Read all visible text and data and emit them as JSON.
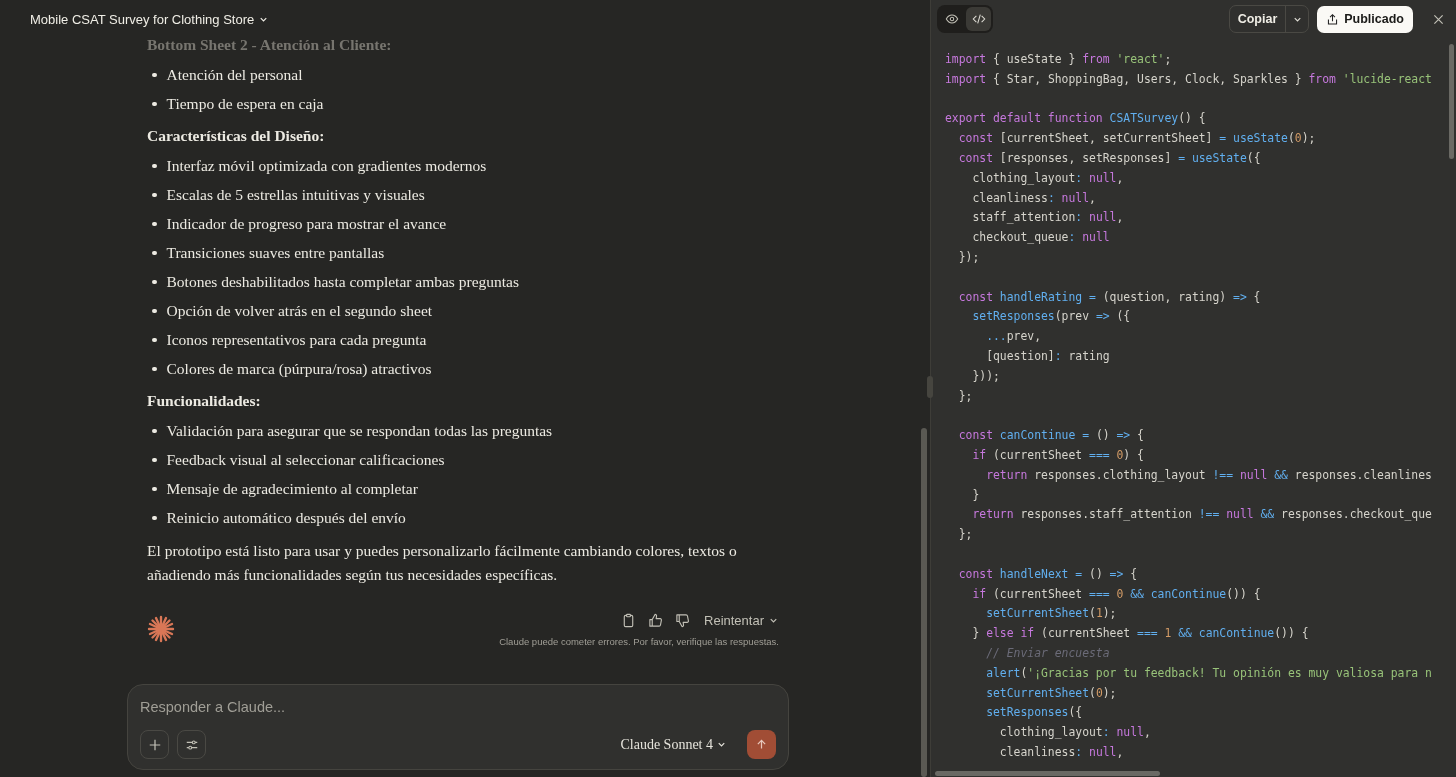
{
  "chat": {
    "title": "Mobile CSAT Survey for Clothing Store",
    "blocks": [
      {
        "kind": "heading",
        "text": "Bottom Sheet 2 - Atención al Cliente:",
        "faded": true
      },
      {
        "kind": "list",
        "faded": false,
        "items": [
          "Atención del personal",
          "Tiempo de espera en caja"
        ]
      },
      {
        "kind": "heading",
        "text": "Características del Diseño:",
        "faded": false
      },
      {
        "kind": "list",
        "faded": false,
        "items": [
          "Interfaz móvil optimizada con gradientes modernos",
          "Escalas de 5 estrellas intuitivas y visuales",
          "Indicador de progreso para mostrar el avance",
          "Transiciones suaves entre pantallas",
          "Botones deshabilitados hasta completar ambas preguntas",
          "Opción de volver atrás en el segundo sheet",
          "Iconos representativos para cada pregunta",
          "Colores de marca (púrpura/rosa) atractivos"
        ]
      },
      {
        "kind": "heading",
        "text": "Funcionalidades:",
        "faded": false
      },
      {
        "kind": "list",
        "faded": false,
        "items": [
          "Validación para asegurar que se respondan todas las preguntas",
          "Feedback visual al seleccionar calificaciones",
          "Mensaje de agradecimiento al completar",
          "Reinicio automático después del envío"
        ]
      },
      {
        "kind": "paragraph",
        "text": "El prototipo está listo para usar y puedes personalizarlo fácilmente cambiando colores, textos o añadiendo más funcionalidades según tus necesidades específicas.",
        "faded": false
      }
    ],
    "retry": "Reintentar",
    "disclaimer": "Claude puede cometer errores. Por favor, verifique las respuestas.",
    "composer": {
      "placeholder": "Responder a Claude...",
      "model": "Claude Sonnet 4"
    }
  },
  "artifact": {
    "view_toggle": [
      {
        "kind": "preview",
        "selected": false
      },
      {
        "kind": "code",
        "selected": true
      }
    ],
    "copy": "Copiar",
    "publish": "Publicado",
    "code_lines": [
      {
        "kind": "code",
        "tokens": [
          {
            "kind": "keyword",
            "text": "import"
          },
          {
            "kind": "plain",
            "text": " { useState } "
          },
          {
            "kind": "keyword",
            "text": "from"
          },
          {
            "kind": "string",
            "text": " 'react'"
          },
          {
            "kind": "plain",
            "text": ";"
          }
        ]
      },
      {
        "kind": "code",
        "tokens": [
          {
            "kind": "keyword",
            "text": "import"
          },
          {
            "kind": "plain",
            "text": " { Star, ShoppingBag, Users, Clock, Sparkles } "
          },
          {
            "kind": "keyword",
            "text": "from"
          },
          {
            "kind": "string",
            "text": " 'lucide-react"
          }
        ]
      },
      {
        "kind": "blank"
      },
      {
        "kind": "code",
        "tokens": [
          {
            "kind": "keyword",
            "text": "export default function"
          },
          {
            "kind": "function",
            "text": " CSATSurvey"
          },
          {
            "kind": "plain",
            "text": "() {"
          }
        ]
      },
      {
        "kind": "code",
        "tokens": [
          {
            "kind": "keyword",
            "text": "  const"
          },
          {
            "kind": "plain",
            "text": " [currentSheet, setCurrentSheet] "
          },
          {
            "kind": "operator",
            "text": "="
          },
          {
            "kind": "function",
            "text": " useState"
          },
          {
            "kind": "plain",
            "text": "("
          },
          {
            "kind": "number",
            "text": "0"
          },
          {
            "kind": "plain",
            "text": ");"
          }
        ]
      },
      {
        "kind": "code",
        "tokens": [
          {
            "kind": "keyword",
            "text": "  const"
          },
          {
            "kind": "plain",
            "text": " [responses, setResponses] "
          },
          {
            "kind": "operator",
            "text": "="
          },
          {
            "kind": "function",
            "text": " useState"
          },
          {
            "kind": "plain",
            "text": "({"
          }
        ]
      },
      {
        "kind": "code",
        "tokens": [
          {
            "kind": "plain",
            "text": "    clothing_layout"
          },
          {
            "kind": "operator",
            "text": ":"
          },
          {
            "kind": "keyword",
            "text": " null"
          },
          {
            "kind": "plain",
            "text": ","
          }
        ]
      },
      {
        "kind": "code",
        "tokens": [
          {
            "kind": "plain",
            "text": "    cleanliness"
          },
          {
            "kind": "operator",
            "text": ":"
          },
          {
            "kind": "keyword",
            "text": " null"
          },
          {
            "kind": "plain",
            "text": ","
          }
        ]
      },
      {
        "kind": "code",
        "tokens": [
          {
            "kind": "plain",
            "text": "    staff_attention"
          },
          {
            "kind": "operator",
            "text": ":"
          },
          {
            "kind": "keyword",
            "text": " null"
          },
          {
            "kind": "plain",
            "text": ","
          }
        ]
      },
      {
        "kind": "code",
        "tokens": [
          {
            "kind": "plain",
            "text": "    checkout_queue"
          },
          {
            "kind": "operator",
            "text": ":"
          },
          {
            "kind": "keyword",
            "text": " null"
          }
        ]
      },
      {
        "kind": "code",
        "tokens": [
          {
            "kind": "plain",
            "text": "  });"
          }
        ]
      },
      {
        "kind": "blank"
      },
      {
        "kind": "code",
        "tokens": [
          {
            "kind": "keyword",
            "text": "  const"
          },
          {
            "kind": "function",
            "text": " handleRating"
          },
          {
            "kind": "operator",
            "text": " ="
          },
          {
            "kind": "plain",
            "text": " (question, rating) "
          },
          {
            "kind": "operator",
            "text": "=>"
          },
          {
            "kind": "plain",
            "text": " {"
          }
        ]
      },
      {
        "kind": "code",
        "tokens": [
          {
            "kind": "function",
            "text": "    setResponses"
          },
          {
            "kind": "plain",
            "text": "(prev "
          },
          {
            "kind": "operator",
            "text": "=>"
          },
          {
            "kind": "plain",
            "text": " ({"
          }
        ]
      },
      {
        "kind": "code",
        "tokens": [
          {
            "kind": "operator",
            "text": "      ..."
          },
          {
            "kind": "plain",
            "text": "prev,"
          }
        ]
      },
      {
        "kind": "code",
        "tokens": [
          {
            "kind": "plain",
            "text": "      [question]"
          },
          {
            "kind": "operator",
            "text": ":"
          },
          {
            "kind": "plain",
            "text": " rating"
          }
        ]
      },
      {
        "kind": "code",
        "tokens": [
          {
            "kind": "plain",
            "text": "    }));"
          }
        ]
      },
      {
        "kind": "code",
        "tokens": [
          {
            "kind": "plain",
            "text": "  };"
          }
        ]
      },
      {
        "kind": "blank"
      },
      {
        "kind": "code",
        "tokens": [
          {
            "kind": "keyword",
            "text": "  const"
          },
          {
            "kind": "function",
            "text": " canContinue"
          },
          {
            "kind": "operator",
            "text": " ="
          },
          {
            "kind": "plain",
            "text": " () "
          },
          {
            "kind": "operator",
            "text": "=>"
          },
          {
            "kind": "plain",
            "text": " {"
          }
        ]
      },
      {
        "kind": "code",
        "tokens": [
          {
            "kind": "keyword",
            "text": "    if"
          },
          {
            "kind": "plain",
            "text": " (currentSheet "
          },
          {
            "kind": "operator",
            "text": "==="
          },
          {
            "kind": "number",
            "text": " 0"
          },
          {
            "kind": "plain",
            "text": ") {"
          }
        ]
      },
      {
        "kind": "code",
        "tokens": [
          {
            "kind": "keyword",
            "text": "      return"
          },
          {
            "kind": "plain",
            "text": " responses.clothing_layout "
          },
          {
            "kind": "operator",
            "text": "!=="
          },
          {
            "kind": "keyword",
            "text": " null"
          },
          {
            "kind": "operator",
            "text": " &&"
          },
          {
            "kind": "plain",
            "text": " responses.cleanlines"
          }
        ]
      },
      {
        "kind": "code",
        "tokens": [
          {
            "kind": "plain",
            "text": "    }"
          }
        ]
      },
      {
        "kind": "code",
        "tokens": [
          {
            "kind": "keyword",
            "text": "    return"
          },
          {
            "kind": "plain",
            "text": " responses.staff_attention "
          },
          {
            "kind": "operator",
            "text": "!=="
          },
          {
            "kind": "keyword",
            "text": " null"
          },
          {
            "kind": "operator",
            "text": " &&"
          },
          {
            "kind": "plain",
            "text": " responses.checkout_que"
          }
        ]
      },
      {
        "kind": "code",
        "tokens": [
          {
            "kind": "plain",
            "text": "  };"
          }
        ]
      },
      {
        "kind": "blank"
      },
      {
        "kind": "code",
        "tokens": [
          {
            "kind": "keyword",
            "text": "  const"
          },
          {
            "kind": "function",
            "text": " handleNext"
          },
          {
            "kind": "operator",
            "text": " ="
          },
          {
            "kind": "plain",
            "text": " () "
          },
          {
            "kind": "operator",
            "text": "=>"
          },
          {
            "kind": "plain",
            "text": " {"
          }
        ]
      },
      {
        "kind": "code",
        "tokens": [
          {
            "kind": "keyword",
            "text": "    if"
          },
          {
            "kind": "plain",
            "text": " (currentSheet "
          },
          {
            "kind": "operator",
            "text": "==="
          },
          {
            "kind": "number",
            "text": " 0"
          },
          {
            "kind": "operator",
            "text": " &&"
          },
          {
            "kind": "function",
            "text": " canContinue"
          },
          {
            "kind": "plain",
            "text": "()) {"
          }
        ]
      },
      {
        "kind": "code",
        "tokens": [
          {
            "kind": "function",
            "text": "      setCurrentSheet"
          },
          {
            "kind": "plain",
            "text": "("
          },
          {
            "kind": "number",
            "text": "1"
          },
          {
            "kind": "plain",
            "text": ");"
          }
        ]
      },
      {
        "kind": "code",
        "tokens": [
          {
            "kind": "plain",
            "text": "    } "
          },
          {
            "kind": "keyword",
            "text": "else if"
          },
          {
            "kind": "plain",
            "text": " (currentSheet "
          },
          {
            "kind": "operator",
            "text": "==="
          },
          {
            "kind": "number",
            "text": " 1"
          },
          {
            "kind": "operator",
            "text": " &&"
          },
          {
            "kind": "function",
            "text": " canContinue"
          },
          {
            "kind": "plain",
            "text": "()) {"
          }
        ]
      },
      {
        "kind": "code",
        "tokens": [
          {
            "kind": "comment",
            "text": "      // Enviar encuesta"
          }
        ]
      },
      {
        "kind": "code",
        "tokens": [
          {
            "kind": "function",
            "text": "      alert"
          },
          {
            "kind": "plain",
            "text": "("
          },
          {
            "kind": "string",
            "text": "'¡Gracias por tu feedback! Tu opinión es muy valiosa para n"
          }
        ]
      },
      {
        "kind": "code",
        "tokens": [
          {
            "kind": "function",
            "text": "      setCurrentSheet"
          },
          {
            "kind": "plain",
            "text": "("
          },
          {
            "kind": "number",
            "text": "0"
          },
          {
            "kind": "plain",
            "text": ");"
          }
        ]
      },
      {
        "kind": "code",
        "tokens": [
          {
            "kind": "function",
            "text": "      setResponses"
          },
          {
            "kind": "plain",
            "text": "({"
          }
        ]
      },
      {
        "kind": "code",
        "tokens": [
          {
            "kind": "plain",
            "text": "        clothing_layout"
          },
          {
            "kind": "operator",
            "text": ":"
          },
          {
            "kind": "keyword",
            "text": " null"
          },
          {
            "kind": "plain",
            "text": ","
          }
        ]
      },
      {
        "kind": "code",
        "tokens": [
          {
            "kind": "plain",
            "text": "        cleanliness"
          },
          {
            "kind": "operator",
            "text": ":"
          },
          {
            "kind": "keyword",
            "text": " null"
          },
          {
            "kind": "plain",
            "text": ","
          }
        ]
      }
    ]
  }
}
